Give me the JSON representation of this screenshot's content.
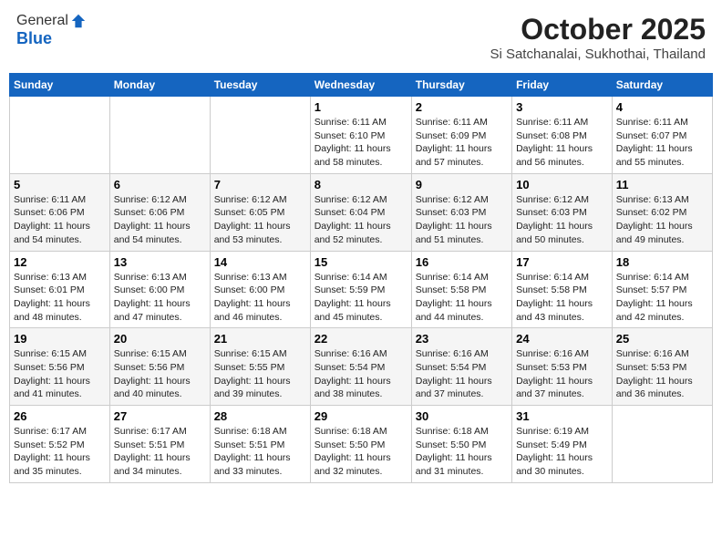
{
  "header": {
    "logo_general": "General",
    "logo_blue": "Blue",
    "month_title": "October 2025",
    "location": "Si Satchanalai, Sukhothai, Thailand"
  },
  "days_of_week": [
    "Sunday",
    "Monday",
    "Tuesday",
    "Wednesday",
    "Thursday",
    "Friday",
    "Saturday"
  ],
  "weeks": [
    [
      {
        "day": "",
        "info": ""
      },
      {
        "day": "",
        "info": ""
      },
      {
        "day": "",
        "info": ""
      },
      {
        "day": "1",
        "info": "Sunrise: 6:11 AM\nSunset: 6:10 PM\nDaylight: 11 hours\nand 58 minutes."
      },
      {
        "day": "2",
        "info": "Sunrise: 6:11 AM\nSunset: 6:09 PM\nDaylight: 11 hours\nand 57 minutes."
      },
      {
        "day": "3",
        "info": "Sunrise: 6:11 AM\nSunset: 6:08 PM\nDaylight: 11 hours\nand 56 minutes."
      },
      {
        "day": "4",
        "info": "Sunrise: 6:11 AM\nSunset: 6:07 PM\nDaylight: 11 hours\nand 55 minutes."
      }
    ],
    [
      {
        "day": "5",
        "info": "Sunrise: 6:11 AM\nSunset: 6:06 PM\nDaylight: 11 hours\nand 54 minutes."
      },
      {
        "day": "6",
        "info": "Sunrise: 6:12 AM\nSunset: 6:06 PM\nDaylight: 11 hours\nand 54 minutes."
      },
      {
        "day": "7",
        "info": "Sunrise: 6:12 AM\nSunset: 6:05 PM\nDaylight: 11 hours\nand 53 minutes."
      },
      {
        "day": "8",
        "info": "Sunrise: 6:12 AM\nSunset: 6:04 PM\nDaylight: 11 hours\nand 52 minutes."
      },
      {
        "day": "9",
        "info": "Sunrise: 6:12 AM\nSunset: 6:03 PM\nDaylight: 11 hours\nand 51 minutes."
      },
      {
        "day": "10",
        "info": "Sunrise: 6:12 AM\nSunset: 6:03 PM\nDaylight: 11 hours\nand 50 minutes."
      },
      {
        "day": "11",
        "info": "Sunrise: 6:13 AM\nSunset: 6:02 PM\nDaylight: 11 hours\nand 49 minutes."
      }
    ],
    [
      {
        "day": "12",
        "info": "Sunrise: 6:13 AM\nSunset: 6:01 PM\nDaylight: 11 hours\nand 48 minutes."
      },
      {
        "day": "13",
        "info": "Sunrise: 6:13 AM\nSunset: 6:00 PM\nDaylight: 11 hours\nand 47 minutes."
      },
      {
        "day": "14",
        "info": "Sunrise: 6:13 AM\nSunset: 6:00 PM\nDaylight: 11 hours\nand 46 minutes."
      },
      {
        "day": "15",
        "info": "Sunrise: 6:14 AM\nSunset: 5:59 PM\nDaylight: 11 hours\nand 45 minutes."
      },
      {
        "day": "16",
        "info": "Sunrise: 6:14 AM\nSunset: 5:58 PM\nDaylight: 11 hours\nand 44 minutes."
      },
      {
        "day": "17",
        "info": "Sunrise: 6:14 AM\nSunset: 5:58 PM\nDaylight: 11 hours\nand 43 minutes."
      },
      {
        "day": "18",
        "info": "Sunrise: 6:14 AM\nSunset: 5:57 PM\nDaylight: 11 hours\nand 42 minutes."
      }
    ],
    [
      {
        "day": "19",
        "info": "Sunrise: 6:15 AM\nSunset: 5:56 PM\nDaylight: 11 hours\nand 41 minutes."
      },
      {
        "day": "20",
        "info": "Sunrise: 6:15 AM\nSunset: 5:56 PM\nDaylight: 11 hours\nand 40 minutes."
      },
      {
        "day": "21",
        "info": "Sunrise: 6:15 AM\nSunset: 5:55 PM\nDaylight: 11 hours\nand 39 minutes."
      },
      {
        "day": "22",
        "info": "Sunrise: 6:16 AM\nSunset: 5:54 PM\nDaylight: 11 hours\nand 38 minutes."
      },
      {
        "day": "23",
        "info": "Sunrise: 6:16 AM\nSunset: 5:54 PM\nDaylight: 11 hours\nand 37 minutes."
      },
      {
        "day": "24",
        "info": "Sunrise: 6:16 AM\nSunset: 5:53 PM\nDaylight: 11 hours\nand 37 minutes."
      },
      {
        "day": "25",
        "info": "Sunrise: 6:16 AM\nSunset: 5:53 PM\nDaylight: 11 hours\nand 36 minutes."
      }
    ],
    [
      {
        "day": "26",
        "info": "Sunrise: 6:17 AM\nSunset: 5:52 PM\nDaylight: 11 hours\nand 35 minutes."
      },
      {
        "day": "27",
        "info": "Sunrise: 6:17 AM\nSunset: 5:51 PM\nDaylight: 11 hours\nand 34 minutes."
      },
      {
        "day": "28",
        "info": "Sunrise: 6:18 AM\nSunset: 5:51 PM\nDaylight: 11 hours\nand 33 minutes."
      },
      {
        "day": "29",
        "info": "Sunrise: 6:18 AM\nSunset: 5:50 PM\nDaylight: 11 hours\nand 32 minutes."
      },
      {
        "day": "30",
        "info": "Sunrise: 6:18 AM\nSunset: 5:50 PM\nDaylight: 11 hours\nand 31 minutes."
      },
      {
        "day": "31",
        "info": "Sunrise: 6:19 AM\nSunset: 5:49 PM\nDaylight: 11 hours\nand 30 minutes."
      },
      {
        "day": "",
        "info": ""
      }
    ]
  ]
}
